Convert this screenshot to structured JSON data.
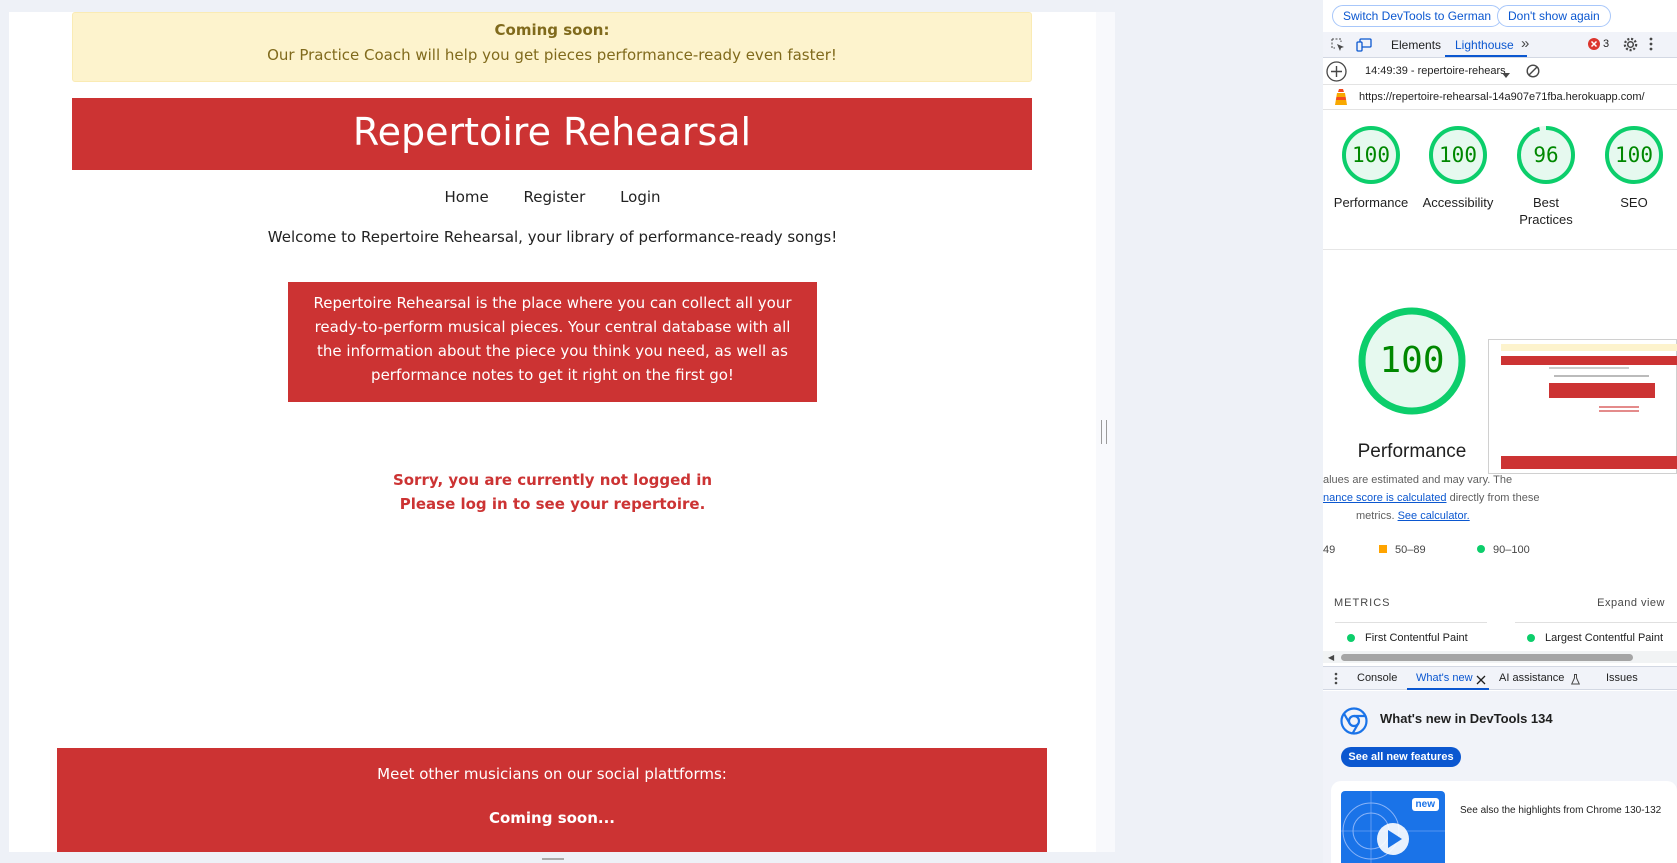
{
  "page": {
    "banner_title": "Coming soon:",
    "banner_text": "Our Practice Coach will help you get pieces performance-ready even faster!",
    "site_title": "Repertoire Rehearsal",
    "nav": [
      "Home",
      "Register",
      "Login"
    ],
    "welcome": "Welcome to Repertoire Rehearsal, your library of performance-ready songs!",
    "intro": "Repertoire Rehearsal is the place where you can collect all your ready-to-perform musical pieces. Your central database with all the information about the piece you think you need, as well as performance notes to get it right on the first go!",
    "not_logged_1": "Sorry, you are currently not logged in",
    "not_logged_2": "Please log in to see your repertoire.",
    "footer_text": "Meet other musicians on our social plattforms:",
    "footer_soon": "Coming soon..."
  },
  "devtools": {
    "switch_lang": "Switch DevTools to German",
    "dont_show": "Don't show again",
    "tabs": {
      "elements": "Elements",
      "lighthouse": "Lighthouse",
      "more": "»"
    },
    "error_count": "3",
    "report_label": "14:49:39 - repertoire-rehears",
    "url": "https://repertoire-rehearsal-14a907e71fba.herokuapp.com/",
    "scores": [
      {
        "value": 100,
        "label": "Performance"
      },
      {
        "value": 100,
        "label": "Accessibility"
      },
      {
        "value": 96,
        "label": "Best Practices"
      },
      {
        "value": 100,
        "label": "SEO"
      }
    ],
    "big_score": {
      "value": 100,
      "label": "Performance"
    },
    "estimate_line1": "alues are estimated and may vary. The",
    "estimate_link": "nance score is calculated",
    "estimate_line2_rest": " directly from these",
    "estimate_line3": "metrics. ",
    "see_calculator": "See calculator.",
    "legend": [
      "49",
      "50–89",
      "90–100"
    ],
    "metrics_heading": "METRICS",
    "expand_view": "Expand view",
    "metrics": [
      "First Contentful Paint",
      "Largest Contentful Paint"
    ],
    "drawer_tabs": {
      "console": "Console",
      "whats_new": "What's new",
      "ai": "AI assistance",
      "issues": "Issues"
    },
    "whats_new_title": "What's new in DevTools 134",
    "see_all": "See all new features",
    "new_badge": "new",
    "highlights": "See also the highlights from Chrome 130-132",
    "colors": {
      "pass": "#0cce6b",
      "average": "#ffa400",
      "brand_red": "#cc3333",
      "link": "#0b57d0"
    }
  }
}
